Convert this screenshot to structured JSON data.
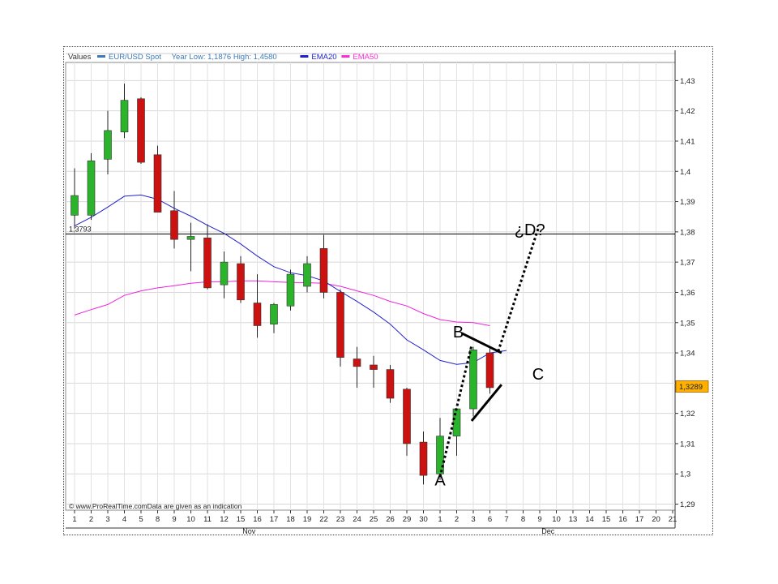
{
  "legend": {
    "values_label": "Values",
    "series": [
      {
        "name": "EUR/USD Spot",
        "color": "#3a7ab8",
        "extra": "Year Low: 1,1876 High: 1,4580"
      },
      {
        "name": "EMA20",
        "color": "#1f1fcf"
      },
      {
        "name": "EMA50",
        "color": "#ff2bd6"
      }
    ]
  },
  "footer": {
    "copyright": "© www.ProRealTime.com",
    "note": "Data are given as an indication"
  },
  "colors": {
    "up": "#2bb32b",
    "down": "#cc1111",
    "ema20": "#2222cc",
    "ema50": "#ee22dd",
    "price_badge": "#ffb000"
  },
  "chart_data": {
    "type": "candlestick",
    "ylim": [
      1.288,
      1.436
    ],
    "y_ticks": [
      {
        "v": 1.29,
        "label": "1,29"
      },
      {
        "v": 1.3,
        "label": "1,3"
      },
      {
        "v": 1.31,
        "label": "1,31"
      },
      {
        "v": 1.32,
        "label": "1,32"
      },
      {
        "v": 1.33,
        "label": ""
      },
      {
        "v": 1.34,
        "label": "1,34"
      },
      {
        "v": 1.35,
        "label": "1,35"
      },
      {
        "v": 1.36,
        "label": "1,36"
      },
      {
        "v": 1.37,
        "label": "1,37"
      },
      {
        "v": 1.38,
        "label": "1,38"
      },
      {
        "v": 1.39,
        "label": "1,39"
      },
      {
        "v": 1.4,
        "label": "1,4"
      },
      {
        "v": 1.41,
        "label": "1,41"
      },
      {
        "v": 1.42,
        "label": "1,42"
      },
      {
        "v": 1.43,
        "label": "1,43"
      }
    ],
    "x_labels": [
      "1",
      "2",
      "3",
      "4",
      "5",
      "8",
      "9",
      "10",
      "11",
      "12",
      "15",
      "16",
      "17",
      "18",
      "19",
      "22",
      "23",
      "24",
      "25",
      "26",
      "29",
      "30",
      "1",
      "2",
      "3",
      "6",
      "7",
      "8",
      "9",
      "10",
      "13",
      "14",
      "15",
      "16",
      "17",
      "20",
      "21"
    ],
    "month_labels": [
      {
        "label": "Nov",
        "index": 10.5
      },
      {
        "label": "Dec",
        "index": 28.5
      }
    ],
    "candles": [
      {
        "o": 1.3855,
        "h": 1.401,
        "l": 1.381,
        "c": 1.392
      },
      {
        "o": 1.3855,
        "h": 1.406,
        "l": 1.384,
        "c": 1.4035
      },
      {
        "o": 1.404,
        "h": 1.42,
        "l": 1.399,
        "c": 1.4135
      },
      {
        "o": 1.413,
        "h": 1.429,
        "l": 1.411,
        "c": 1.4235
      },
      {
        "o": 1.424,
        "h": 1.4245,
        "l": 1.4025,
        "c": 1.403
      },
      {
        "o": 1.4055,
        "h": 1.4085,
        "l": 1.3865,
        "c": 1.3865
      },
      {
        "o": 1.387,
        "h": 1.3935,
        "l": 1.3745,
        "c": 1.3775
      },
      {
        "o": 1.3775,
        "h": 1.383,
        "l": 1.367,
        "c": 1.3785
      },
      {
        "o": 1.378,
        "h": 1.3825,
        "l": 1.361,
        "c": 1.3615
      },
      {
        "o": 1.3625,
        "h": 1.3735,
        "l": 1.358,
        "c": 1.37
      },
      {
        "o": 1.3695,
        "h": 1.372,
        "l": 1.3565,
        "c": 1.3575
      },
      {
        "o": 1.3565,
        "h": 1.366,
        "l": 1.345,
        "c": 1.349
      },
      {
        "o": 1.3495,
        "h": 1.3565,
        "l": 1.3465,
        "c": 1.356
      },
      {
        "o": 1.3555,
        "h": 1.3675,
        "l": 1.354,
        "c": 1.366
      },
      {
        "o": 1.362,
        "h": 1.372,
        "l": 1.36,
        "c": 1.3695
      },
      {
        "o": 1.3745,
        "h": 1.379,
        "l": 1.358,
        "c": 1.36
      },
      {
        "o": 1.36,
        "h": 1.361,
        "l": 1.3355,
        "c": 1.3385
      },
      {
        "o": 1.338,
        "h": 1.342,
        "l": 1.3285,
        "c": 1.3355
      },
      {
        "o": 1.336,
        "h": 1.339,
        "l": 1.3285,
        "c": 1.3345
      },
      {
        "o": 1.3345,
        "h": 1.336,
        "l": 1.3235,
        "c": 1.325
      },
      {
        "o": 1.328,
        "h": 1.3285,
        "l": 1.306,
        "c": 1.31
      },
      {
        "o": 1.3105,
        "h": 1.314,
        "l": 1.2965,
        "c": 1.2995
      },
      {
        "o": 1.3,
        "h": 1.3185,
        "l": 1.298,
        "c": 1.3125
      },
      {
        "o": 1.3125,
        "h": 1.3215,
        "l": 1.306,
        "c": 1.3215
      },
      {
        "o": 1.3215,
        "h": 1.342,
        "l": 1.319,
        "c": 1.341
      },
      {
        "o": 1.34,
        "h": 1.3415,
        "l": 1.3265,
        "c": 1.3285
      }
    ],
    "ema20": [
      1.382,
      1.3848,
      1.3882,
      1.3918,
      1.3922,
      1.3908,
      1.3878,
      1.3852,
      1.3822,
      1.3795,
      1.376,
      1.372,
      1.3685,
      1.3665,
      1.3655,
      1.3638,
      1.3603,
      1.357,
      1.3535,
      1.3495,
      1.3443,
      1.341,
      1.3375,
      1.3362,
      1.3368,
      1.34,
      1.3408
    ],
    "ema50": [
      1.3525,
      1.3543,
      1.356,
      1.359,
      1.3605,
      1.3615,
      1.3622,
      1.363,
      1.3635,
      1.3635,
      1.3638,
      1.3638,
      1.3635,
      1.3633,
      1.3632,
      1.363,
      1.362,
      1.3605,
      1.359,
      1.357,
      1.3555,
      1.353,
      1.351,
      1.3502,
      1.35,
      1.349
    ],
    "reference_level": {
      "value": 1.3793,
      "label": "1,3793"
    },
    "last_price": {
      "value": 1.3289,
      "label": "1,3289"
    },
    "annotations": [
      {
        "text": "A",
        "index": 22,
        "value": 1.298
      },
      {
        "text": "B",
        "index": 23.1,
        "value": 1.347
      },
      {
        "text": "C",
        "index": 27.9,
        "value": 1.333
      },
      {
        "text": "¿D?",
        "index": 27.4,
        "value": 1.3808
      }
    ],
    "pattern_lines": [
      {
        "style": "dotted",
        "from": {
          "index": 22,
          "value": 1.299
        },
        "to": {
          "index": 23.9,
          "value": 1.3425
        }
      },
      {
        "style": "solid",
        "from": {
          "index": 23.3,
          "value": 1.3465
        },
        "to": {
          "index": 25.7,
          "value": 1.34
        }
      },
      {
        "style": "solid",
        "from": {
          "index": 23.9,
          "value": 1.3175
        },
        "to": {
          "index": 25.7,
          "value": 1.3295
        }
      },
      {
        "style": "dotted",
        "from": {
          "index": 25.5,
          "value": 1.3405
        },
        "to": {
          "index": 27.9,
          "value": 1.381
        }
      }
    ]
  }
}
